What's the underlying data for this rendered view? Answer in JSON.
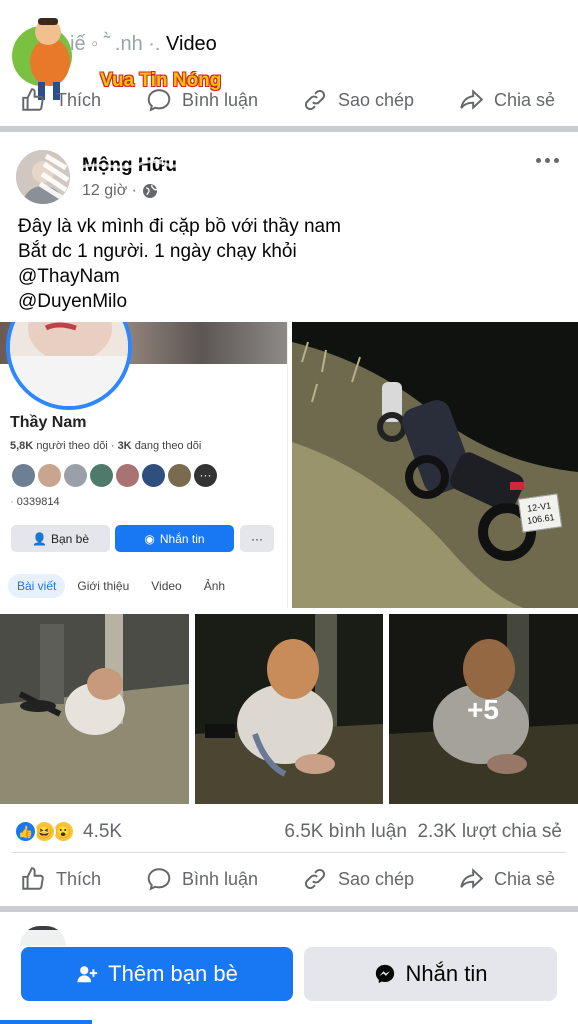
{
  "top_post": {
    "partial_title": "Video",
    "watermark": "Vua Tin Nóng"
  },
  "actions": {
    "like": "Thích",
    "comment": "Bình luận",
    "copy": "Sao chép",
    "share": "Chia sẻ"
  },
  "post": {
    "author": "Mộng Hữu",
    "time": "12 giờ ·",
    "text_lines": [
      "Đây là vk mình đi cặp bồ với thầy nam",
      "Bắt dc 1 người. 1 ngày chạy khỏi",
      "@ThayNam",
      "@DuyenMilo"
    ],
    "more_icon": "more-horizontal-icon"
  },
  "embedded_profile": {
    "name": "Thầy Nam",
    "followers": "5,8K",
    "followers_label": "người theo dõi",
    "following": "3K",
    "following_label": "đang theo dõi",
    "phone_partial": "0339814",
    "btn_friends": "Bạn bè",
    "btn_message": "Nhắn tin",
    "btn_more": "···",
    "tabs": [
      "Bài viết",
      "Giới thiệu",
      "Video",
      "Ảnh"
    ]
  },
  "photos": {
    "more_count": "+5",
    "plate_text": "12-V1 106.61"
  },
  "reactions": {
    "count": "4.5K",
    "comments": "6.5K bình luận",
    "shares": "2.3K lượt chia sẻ"
  },
  "bottom_buttons": {
    "add_friend": "Thêm bạn bè",
    "message": "Nhắn tin"
  },
  "colors": {
    "facebook_blue": "#1877f2",
    "gray_text": "#65676b",
    "button_gray": "#e4e6eb"
  }
}
